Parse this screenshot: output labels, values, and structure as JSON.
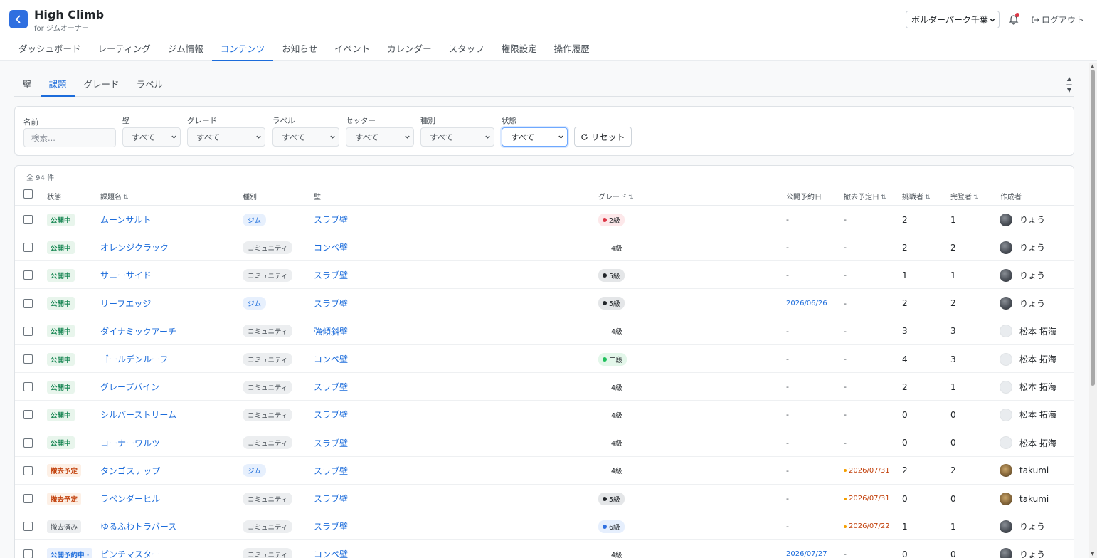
{
  "header": {
    "app_title": "High Climb",
    "app_subtitle": "for ジムオーナー",
    "gym_select": "ボルダーパーク千葉",
    "logout": "ログアウト"
  },
  "main_nav": [
    "ダッシュボード",
    "レーティング",
    "ジム情報",
    "コンテンツ",
    "お知らせ",
    "イベント",
    "カレンダー",
    "スタッフ",
    "権限設定",
    "操作履歴"
  ],
  "main_nav_active": "コンテンツ",
  "sub_nav": [
    "壁",
    "課題",
    "グレード",
    "ラベル"
  ],
  "sub_nav_active": "課題",
  "filters": {
    "name_label": "名前",
    "name_placeholder": "検索...",
    "wall_label": "壁",
    "wall_value": "すべて",
    "grade_label": "グレード",
    "grade_value": "すべて",
    "label_label": "ラベル",
    "label_value": "すべて",
    "setter_label": "セッター",
    "setter_value": "すべて",
    "type_label": "種別",
    "type_value": "すべて",
    "status_label": "状態",
    "status_value": "すべて",
    "reset": "リセット"
  },
  "table": {
    "total": "全 94 件",
    "headers": {
      "status": "状態",
      "name": "課題名",
      "type": "種別",
      "wall": "壁",
      "grade": "グレード",
      "publish_date": "公開予約日",
      "remove_date": "撤去予定日",
      "challengers": "挑戦者",
      "completers": "完登者",
      "creator": "作成者"
    },
    "sort_icon": "⇅",
    "rows": [
      {
        "status": "公開中",
        "name": "ムーンサルト",
        "type": "ジム",
        "wall": "スラブ壁",
        "grade": "2級",
        "publish": "-",
        "remove": "-",
        "challengers": "2",
        "completers": "1",
        "creator": "りょう"
      },
      {
        "status": "公開中",
        "name": "オレンジクラック",
        "type": "コミュニティ",
        "wall": "コンペ壁",
        "grade": "4級",
        "publish": "-",
        "remove": "-",
        "challengers": "2",
        "completers": "2",
        "creator": "りょう"
      },
      {
        "status": "公開中",
        "name": "サニーサイド",
        "type": "コミュニティ",
        "wall": "スラブ壁",
        "grade": "5級",
        "publish": "-",
        "remove": "-",
        "challengers": "1",
        "completers": "1",
        "creator": "りょう"
      },
      {
        "status": "公開中",
        "name": "リーフエッジ",
        "type": "ジム",
        "wall": "スラブ壁",
        "grade": "5級",
        "publish": "2026/06/26",
        "remove": "-",
        "challengers": "2",
        "completers": "2",
        "creator": "りょう"
      },
      {
        "status": "公開中",
        "name": "ダイナミックアーチ",
        "type": "コミュニティ",
        "wall": "強傾斜壁",
        "grade": "4級",
        "publish": "-",
        "remove": "-",
        "challengers": "3",
        "completers": "3",
        "creator": "松本 拓海"
      },
      {
        "status": "公開中",
        "name": "ゴールデンルーフ",
        "type": "コミュニティ",
        "wall": "コンペ壁",
        "grade": "二段",
        "publish": "-",
        "remove": "-",
        "challengers": "4",
        "completers": "3",
        "creator": "松本 拓海"
      },
      {
        "status": "公開中",
        "name": "グレープバイン",
        "type": "コミュニティ",
        "wall": "スラブ壁",
        "grade": "4級",
        "publish": "-",
        "remove": "-",
        "challengers": "2",
        "completers": "1",
        "creator": "松本 拓海"
      },
      {
        "status": "公開中",
        "name": "シルバーストリーム",
        "type": "コミュニティ",
        "wall": "スラブ壁",
        "grade": "4級",
        "publish": "-",
        "remove": "-",
        "challengers": "0",
        "completers": "0",
        "creator": "松本 拓海"
      },
      {
        "status": "公開中",
        "name": "コーナーワルツ",
        "type": "コミュニティ",
        "wall": "スラブ壁",
        "grade": "4級",
        "publish": "-",
        "remove": "-",
        "challengers": "0",
        "completers": "0",
        "creator": "松本 拓海"
      },
      {
        "status": "撤去予定",
        "name": "タンゴステップ",
        "type": "ジム",
        "wall": "スラブ壁",
        "grade": "4級",
        "publish": "-",
        "remove": "2026/07/31",
        "challengers": "2",
        "completers": "2",
        "creator": "takumi"
      },
      {
        "status": "撤去予定",
        "name": "ラベンダーヒル",
        "type": "コミュニティ",
        "wall": "スラブ壁",
        "grade": "5級",
        "publish": "-",
        "remove": "2026/07/31",
        "challengers": "0",
        "completers": "0",
        "creator": "takumi"
      },
      {
        "status": "撤去済み",
        "name": "ゆるふわトラバース",
        "type": "コミュニティ",
        "wall": "スラブ壁",
        "grade": "6級",
        "publish": "-",
        "remove": "2026/07/22",
        "challengers": "1",
        "completers": "1",
        "creator": "りょう"
      },
      {
        "status": "公開予約中 ·",
        "name": "ピンチマスター",
        "type": "コミュニティ",
        "wall": "コンペ壁",
        "grade": "4級",
        "publish": "2026/07/27",
        "remove": "-",
        "challengers": "0",
        "completers": "0",
        "creator": "りょう"
      }
    ]
  },
  "colors": {
    "accent": "#1c6cdb",
    "status_published": "#198754",
    "status_removal": "#c2410c",
    "grade_2kyu": "#dc3545",
    "grade_5kyu": "#212529",
    "grade_nidan": "#20c05c",
    "grade_6kyu": "#2f6fe0"
  },
  "icons": [
    "app-logo-icon",
    "bell-icon",
    "logout-icon",
    "refresh-icon",
    "chevron-down-icon",
    "sort-icon"
  ]
}
